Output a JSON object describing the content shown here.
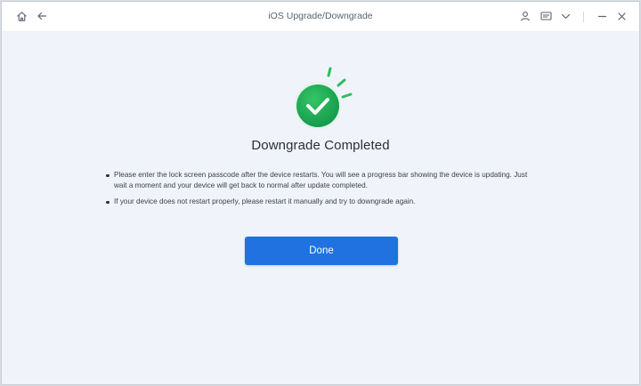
{
  "window": {
    "title": "iOS Upgrade/Downgrade"
  },
  "titlebar": {
    "icons": [
      "home-icon",
      "back-arrow-icon",
      "account-icon",
      "feedback-icon",
      "dropdown-icon",
      "minimize-icon",
      "close-icon"
    ]
  },
  "result": {
    "heading": "Downgrade Completed",
    "status_icon": "checkmark-success-icon",
    "notes": [
      "Please enter the lock screen passcode after the device restarts. You will see a progress bar showing the device is updating. Just wait a moment and your device will get back to normal after update completed.",
      "If your device does not restart properly, please restart it manually and try to downgrade again."
    ]
  },
  "actions": {
    "done_label": "Done"
  },
  "colors": {
    "accent": "#1f72e0",
    "success": "#16a34a",
    "background": "#f0f4fa"
  }
}
